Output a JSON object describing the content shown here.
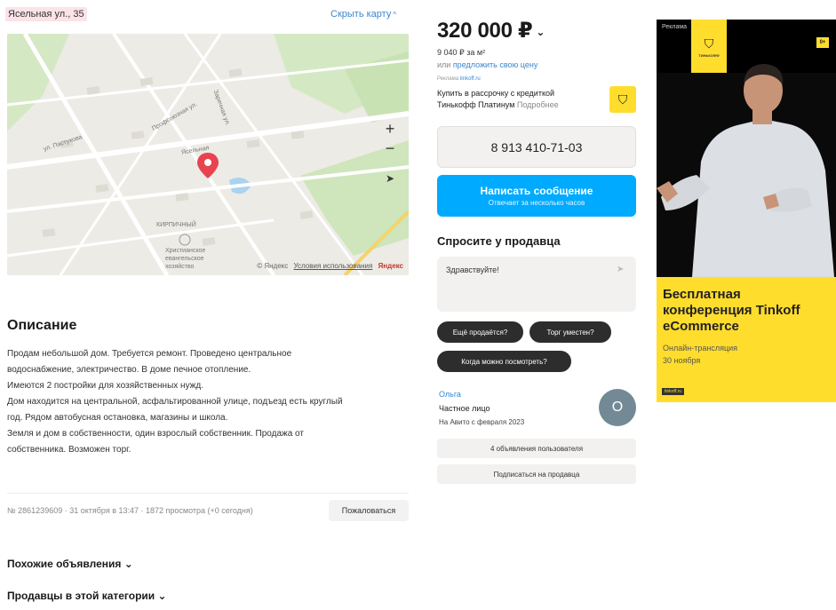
{
  "listing": {
    "address": "Ясельная ул., 35",
    "hide_map": "Скрыть карту",
    "price": "320 000 ₽",
    "price_per_m2": "9 040 ₽ за м²",
    "offer_prefix": "или ",
    "offer_link": "предложить свою цену"
  },
  "map": {
    "zoom_in": "+",
    "zoom_out": "−",
    "locate": "➤",
    "street_1": "ул. Пастухова",
    "street_2": "Ясельная",
    "street_3": "Профсоюзная ул.",
    "street_4": "Заречная ул.",
    "poi_1": "КИРПИЧНЫЙ",
    "poi_2": "Христианское евангельское хозяйство",
    "footer_copy": "© Яндекс",
    "footer_terms": "Условия использования",
    "footer_brand": "Яндекс"
  },
  "description": {
    "title": "Описание",
    "lines": [
      "Продам небольшой дом. Требуется ремонт. Проведено центральное",
      "водоснабжение, электричество. В доме печное отопление.",
      "Имеются 2 постройки для хозяйственных нужд.",
      "Дом находится на центральной, асфальтированной улице, подъезд есть круглый",
      "год. Рядом автобусная остановка, магазины и школа.",
      "Земля и дом в собственности, один взрослый собственник. Продажа от",
      "собственника. Возможен торг."
    ]
  },
  "meta": {
    "info": "№ 2861239609 · 31 октября в 13:47 · 1872 просмотра (+0 сегодня)",
    "complain": "Пожаловаться"
  },
  "sections": {
    "similar": "Похожие объявления",
    "sellers": "Продавцы в этой категории"
  },
  "small_ad": {
    "label": "Реклама",
    "label_link": "tinkoff.ru",
    "text": "Купить в рассрочку с кредиткой Тинькофф Платинум",
    "more": "Подробнее"
  },
  "contact": {
    "phone": "8 913 410-71-03",
    "message_main": "Написать сообщение",
    "message_sub": "Отвечает за несколько часов"
  },
  "ask": {
    "title": "Спросите у продавца",
    "input_value": "Здравствуйте!",
    "chips": [
      "Ещё продаётся?",
      "Торг уместен?",
      "Когда можно посмотреть?"
    ]
  },
  "seller": {
    "name": "Ольга",
    "type": "Частное лицо",
    "since": "На Авито с февраля 2023",
    "avatar_letter": "О",
    "listings_btn": "4 объявления пользователя",
    "subscribe_btn": "Подписаться на продавца"
  },
  "banner": {
    "top_label": "Реклама",
    "logo_word": "ТИНЬКОФФ",
    "age": "0+",
    "headline": "Бесплатная конференция Tinkoff eCommerce",
    "sub_1": "Онлайн-трансляция",
    "sub_2": "30 ноября",
    "foot": "tinkoff.ru"
  },
  "icons": {
    "map_pin": "map-pin-icon",
    "send": "send-icon",
    "chevron": "chevron-down-icon"
  },
  "colors": {
    "link": "#3a87d1",
    "primary_button": "#00aaff",
    "chip": "#2d2d2d",
    "tinkoff_yellow": "#ffdd2d",
    "pin": "#e8434f"
  }
}
